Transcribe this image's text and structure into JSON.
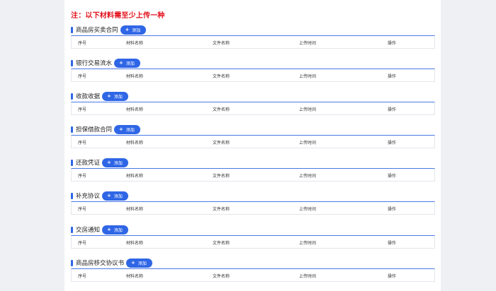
{
  "notice": "注：以下材料需至少上传一种",
  "add_label": "添加",
  "columns": [
    "序号",
    "材料名称",
    "文件名称",
    "上传时间",
    "操作"
  ],
  "sections": [
    {
      "title": "商品房买卖合同"
    },
    {
      "title": "银行交易流水"
    },
    {
      "title": "收款收据"
    },
    {
      "title": "担保借款合同"
    },
    {
      "title": "还款凭证"
    },
    {
      "title": "补充协议"
    },
    {
      "title": "交房通知"
    },
    {
      "title": "商品房移交协议书"
    }
  ],
  "colors": {
    "accent": "#2f66e6",
    "notice": "#e3101c"
  }
}
